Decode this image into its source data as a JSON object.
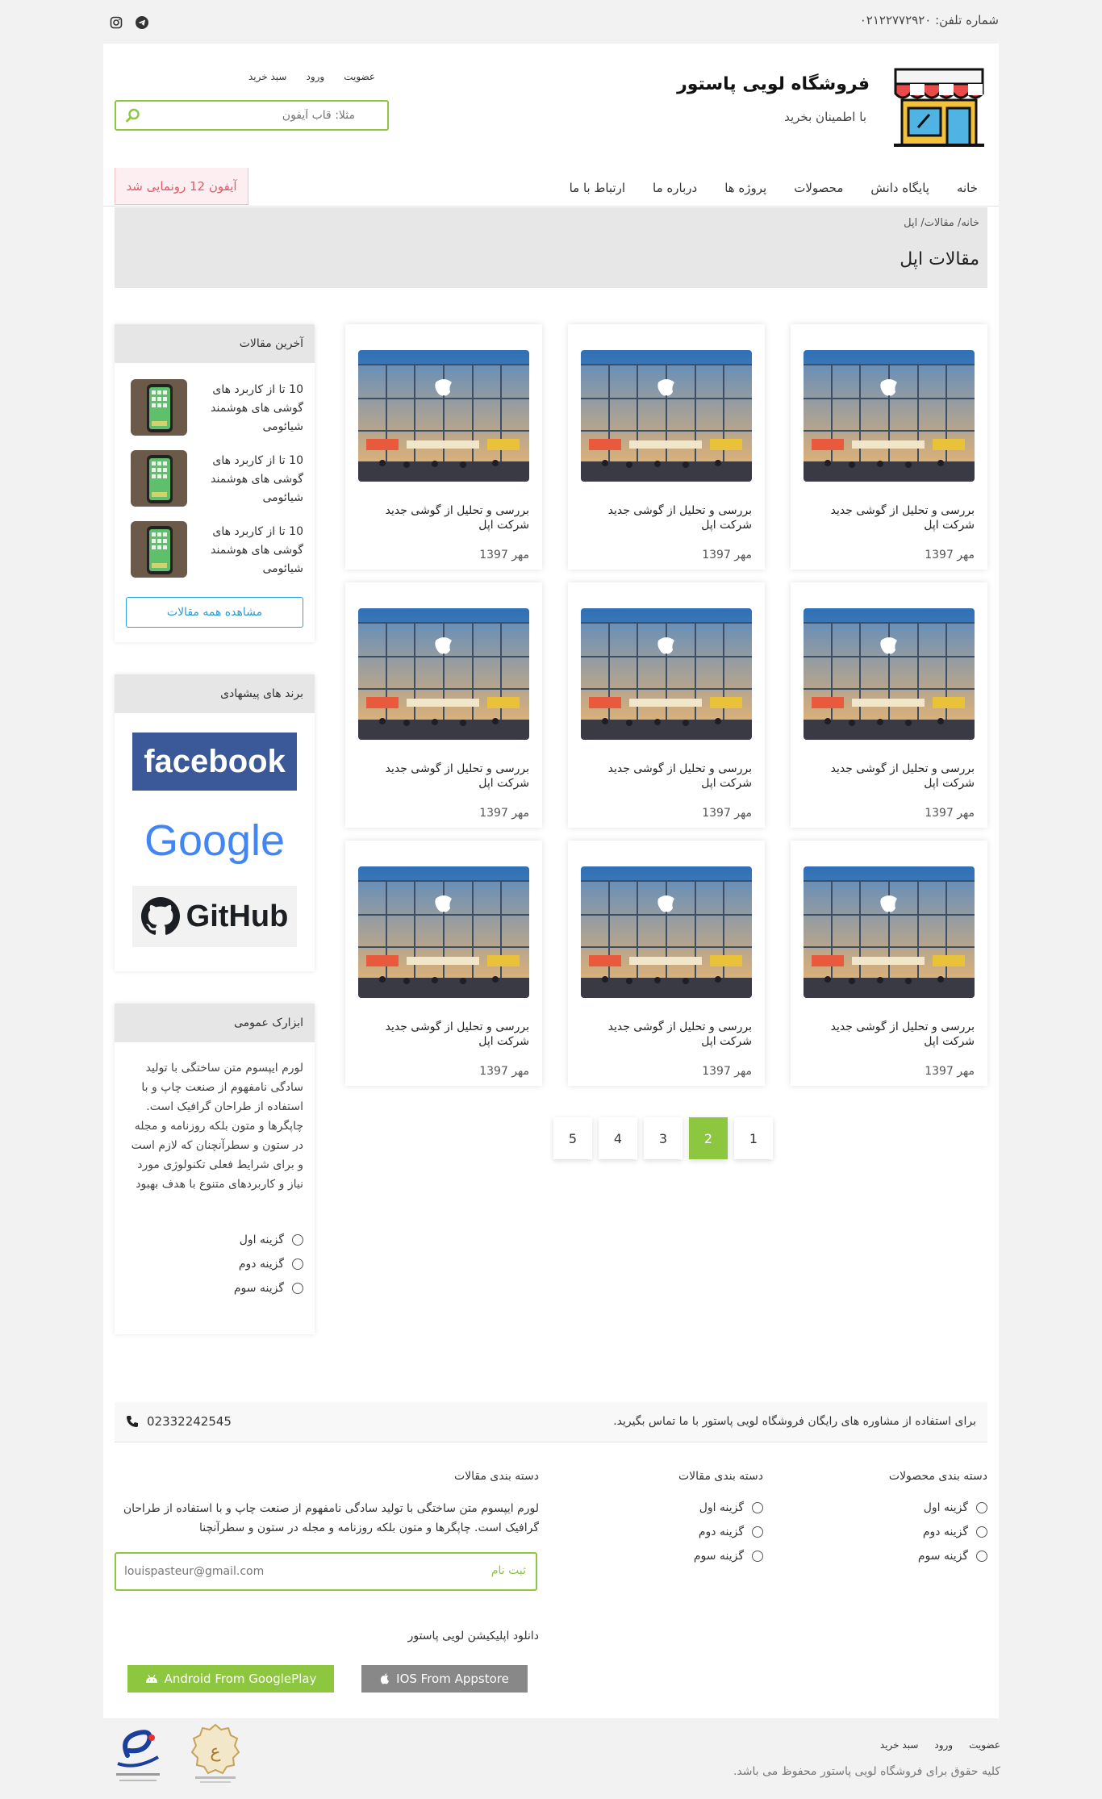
{
  "topbar": {
    "phone": "شماره تلفن: ۰۲۱۲۲۷۷۲۹۲۰"
  },
  "header": {
    "title": "فروشگاه لویی پاستور",
    "slogan": "با اطمینان بخرید",
    "links": {
      "register": "عضویت",
      "login": "ورود",
      "cart": "سبد خرید"
    },
    "search_placeholder": "مثلا: قاب آیفون"
  },
  "nav": {
    "items": [
      "خانه",
      "پایگاه دانش",
      "محصولات",
      "پروژه ها",
      "درباره ما",
      "ارتباط با ما"
    ],
    "promo": "آیفون 12 رونمایی شد"
  },
  "hero": {
    "breadcrumb": "خانه/ مقالات/ اپل",
    "title": "مقالات اپل"
  },
  "articles": [
    {
      "title": "بررسی و تحلیل از گوشی جدید شرکت اپل",
      "date": "مهر 1397"
    },
    {
      "title": "بررسی و تحلیل از گوشی جدید شرکت اپل",
      "date": "مهر 1397"
    },
    {
      "title": "بررسی و تحلیل از گوشی جدید شرکت اپل",
      "date": "مهر 1397"
    },
    {
      "title": "بررسی و تحلیل از گوشی جدید شرکت اپل",
      "date": "مهر 1397"
    },
    {
      "title": "بررسی و تحلیل از گوشی جدید شرکت اپل",
      "date": "مهر 1397"
    },
    {
      "title": "بررسی و تحلیل از گوشی جدید شرکت اپل",
      "date": "مهر 1397"
    },
    {
      "title": "بررسی و تحلیل از گوشی جدید شرکت اپل",
      "date": "مهر 1397"
    },
    {
      "title": "بررسی و تحلیل از گوشی جدید شرکت اپل",
      "date": "مهر 1397"
    },
    {
      "title": "بررسی و تحلیل از گوشی جدید شرکت اپل",
      "date": "مهر 1397"
    }
  ],
  "pagination": {
    "pages": [
      "5",
      "4",
      "3",
      "2",
      "1"
    ],
    "active": "2"
  },
  "sidebar": {
    "recent": {
      "title": "آخرین مقالات",
      "items": [
        "10 تا از کاربرد های گوشی های هوشمند شیائومی",
        "10 تا از کاربرد های گوشی های هوشمند شیائومی",
        "10 تا از کاربرد های گوشی های هوشمند شیائومی"
      ],
      "all_button": "مشاهده همه مقالات"
    },
    "brands": {
      "title": "برند های پیشهادی",
      "facebook": "facebook",
      "google": "Google",
      "github": "GitHub"
    },
    "tools": {
      "title": "ابزارک عمومی",
      "text": "لورم ایپسوم متن ساختگی با تولید سادگی نامفهوم از صنعت چاپ و با استفاده از طراحان گرافیک است. چاپگرها و متون بلکه روزنامه و مجله در ستون و سطرآنچنان که لازم است و برای شرایط فعلی تکنولوژی مورد نیاز و کاربردهای متنوع با هدف بهبود",
      "options": [
        "گزینه اول",
        "گزینه دوم",
        "گزینه سوم"
      ]
    }
  },
  "footer": {
    "consult": "برای استفاده از مشاوره های رایگان فروشگاه لویی پاستور با ما تماس بگیرید.",
    "phone": "02332242545",
    "col1": {
      "title": "دسته بندی محصولات",
      "options": [
        "گزینه اول",
        "گزینه دوم",
        "گزینه سوم"
      ]
    },
    "col2": {
      "title": "دسته بندی مقالات",
      "options": [
        "گزینه اول",
        "گزینه دوم",
        "گزینه سوم"
      ]
    },
    "col3": {
      "title": "دسته بندی مقالات",
      "text": "لورم ایپسوم متن ساختگی با تولید سادگی نامفهوم از صنعت چاپ و با استفاده از طراحان گرافیک است. چاپگرها و متون بلکه روزنامه و مجله در ستون و سطرآنچنا"
    },
    "newsletter": {
      "button": "ثبت نام",
      "value": "louispasteur@gmail.com"
    },
    "app_title": "دانلود اپلیکیشن لویی پاستور",
    "android": "Android From GooglePlay",
    "ios": "IOS From Appstore",
    "bottom_links": {
      "register": "عضویت",
      "login": "ورود",
      "cart": "سبد خرید"
    },
    "copyright": "کلیه حقوق برای فروشگاه لویی پاستور محفوظ می باشد."
  }
}
